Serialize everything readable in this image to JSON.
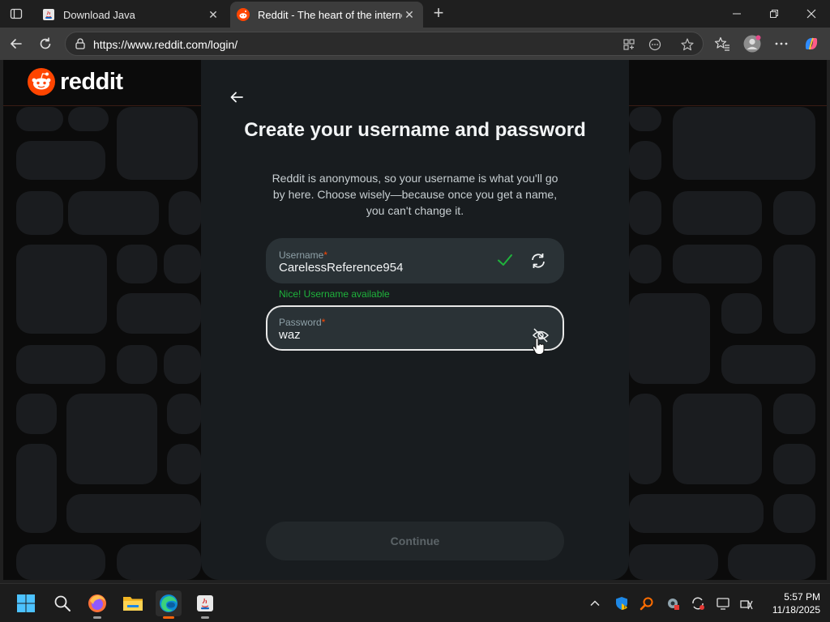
{
  "browser": {
    "tabs": [
      {
        "title": "Download Java",
        "active": false
      },
      {
        "title": "Reddit - The heart of the internet",
        "active": true
      }
    ],
    "url": "https://www.reddit.com/login/"
  },
  "site": {
    "brand": "reddit",
    "accent_color": "#ff4500"
  },
  "signup": {
    "title": "Create your username and password",
    "subtitle": "Reddit is anonymous, so your username is what you'll go by here. Choose wisely—because once you get a name, you can't change it.",
    "username_label": "Username",
    "username_value": "CarelessReference954",
    "username_status": "Nice! Username available",
    "password_label": "Password",
    "password_value": "waz",
    "required_mark": "*",
    "continue_label": "Continue",
    "status_color": "#1fb33c"
  },
  "taskbar": {
    "apps": [
      "start-icon",
      "search-icon",
      "firefox-icon",
      "file-explorer-icon",
      "edge-icon",
      "java-installer-icon"
    ],
    "tray": [
      "chevron-up-icon",
      "security-shield-icon",
      "search-tool-icon",
      "settings-tool-icon",
      "sync-icon",
      "display-icon",
      "network-icon"
    ],
    "time": "5:57 PM",
    "date": "11/18/2025"
  }
}
